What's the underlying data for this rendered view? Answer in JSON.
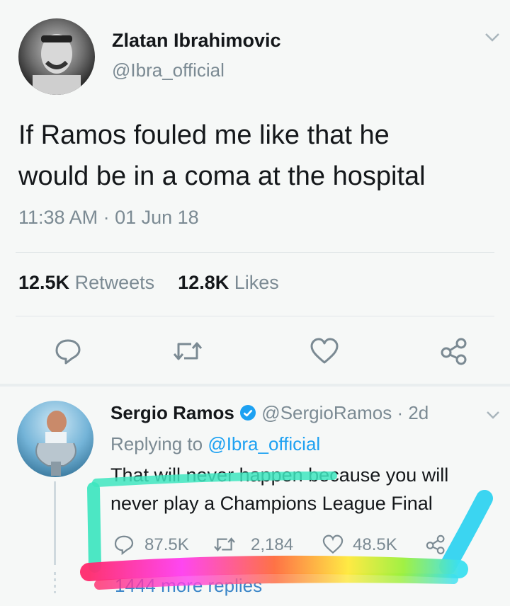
{
  "tweet": {
    "author_name": "Zlatan Ibrahimovic",
    "handle": "@Ibra_official",
    "text_line1": "If Ramos fouled me like that he",
    "text_line2": "would be in a coma at the hospital",
    "timestamp": "11:38 AM · 01 Jun 18",
    "retweets_count": "12.5K",
    "retweets_label": "Retweets",
    "likes_count": "12.8K",
    "likes_label": "Likes"
  },
  "reply": {
    "author_name": "Sergio Ramos",
    "handle": "@SergioRamos",
    "time": "· 2d",
    "replying_prefix": "Replying to",
    "replying_to": "@Ibra_official",
    "text_line1": "That will never happen because you will",
    "text_line2": "never play a Champions League Final",
    "reply_count": "87.5K",
    "retweet_count": "2,184",
    "like_count": "48.5K",
    "more_replies": "1444 more replies"
  },
  "colors": {
    "background": "#f6f8f7",
    "muted": "#7b8a93",
    "verified": "#1da1f2",
    "annotation_teal": "#3ee6c0",
    "annotation_blue": "#2ad1f0"
  },
  "icons": [
    "chevron-down-icon",
    "reply-icon",
    "retweet-icon",
    "like-icon",
    "share-icon",
    "verified-badge-icon"
  ]
}
